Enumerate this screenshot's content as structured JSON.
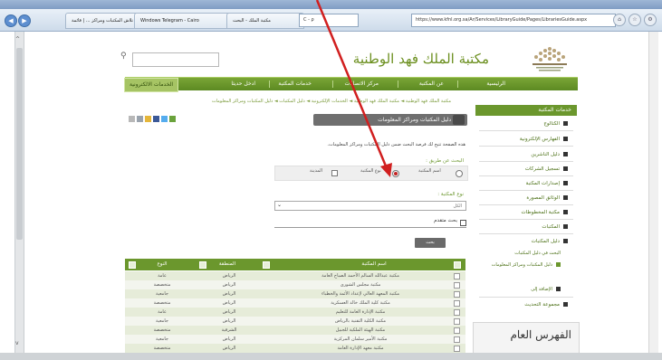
{
  "browser": {
    "tabs": [
      "تلاش المكتبات ومراكز ... | قائمة",
      "Windows Telegram - Cairo",
      "مكتبة الملك - البحث"
    ],
    "address": "https://www.kfnl.org.sa/Ar/Services/LibraryGuide/Pages/LibrariesGuide.aspx",
    "address_suffix": "C - ρ"
  },
  "site": {
    "title": "مكتبة الملك فهد الوطنية",
    "nav": [
      "الرئيسية",
      "عن المكتبة",
      "مركز الاتصالات",
      "خدمات المكتبة",
      "ادخل حديثا",
      "الخدمات الالكترونية"
    ],
    "breadcrumb": "مكتبة الملك فهد الوطنية  ◄  مكتبة الملك فهد الوطنية  ◄  الخدمات الإلكترونية  ◄  دليل المكتبات  ◄  دليل المكتبات ومراكز المعلومات"
  },
  "sidebar": {
    "heading": "خدمات المكتبة",
    "items": [
      "الكتالوج",
      "الفهارس الإلكترونية",
      "دليل الناشرين",
      "تسجيل الشركات",
      "إصدارات المكتبة",
      "الوثائق المصورة",
      "مكتبة المخطوطات",
      "المكتبات",
      "دليل المكتبات",
      "البحث في دليل المكتبات",
      "دليل المكتبات ومراكز المعلومات",
      "الإضافة إلى",
      "مجموعة التحديث"
    ],
    "banner": "الفهرس العام"
  },
  "content": {
    "title": "دليل المكتبات ومراكز المعلومات",
    "intro": "هذه الصفحة تتيح لك فرصة البحث ضمن دليل المكتبات ومراكز المعلومات.",
    "search_by_label": "البحث عن طريق :",
    "radio_options": [
      "اسم المكتبة",
      "نوع المكتبة",
      "المدينة"
    ],
    "type_label": "نوع المكتبة :",
    "select_value": "الكل",
    "advanced_label": "بحث متقدم",
    "search_button": "بحث"
  },
  "table": {
    "headers": [
      "اسم المكتبة",
      "المنطقة",
      "النوع"
    ],
    "rows": [
      [
        "مكتبة عبدالله السالم الأحمد الصباح العامة",
        "الرياض",
        "عامة"
      ],
      [
        "مكتبة مجلس الشورى",
        "الرياض",
        "متخصصة"
      ],
      [
        "مكتبة المعهد العالي لإعداد الأئمة والخطباء",
        "الرياض",
        "جامعية"
      ],
      [
        "مكتبة كلية الملك خالد العسكرية",
        "الرياض",
        "متخصصة"
      ],
      [
        "مكتبة الإدارة العامة للتعليم",
        "الرياض",
        "عامة"
      ],
      [
        "مكتبة الكلية التقنية بالرياض",
        "الرياض",
        "جامعية"
      ],
      [
        "مكتبة الهيئة الملكية للجبيل",
        "الشرقية",
        "متخصصة"
      ],
      [
        "مكتبة الأمير سلمان المركزية",
        "الرياض",
        "جامعية"
      ],
      [
        "مكتبة معهد الإدارة العامة",
        "الرياض",
        "متخصصة"
      ]
    ]
  },
  "colors": {
    "accent": "#6b972d",
    "annotation": "#d11f1f"
  }
}
